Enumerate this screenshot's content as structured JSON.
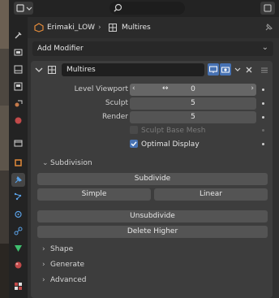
{
  "breadcrumb": {
    "object_name": "Erimaki_LOW",
    "separator": "›",
    "modifier_name": "Multires"
  },
  "add_modifier": {
    "label": "Add Modifier"
  },
  "modifier": {
    "name_value": "Multires",
    "rows": [
      {
        "label": "Level Viewport",
        "value": "0"
      },
      {
        "label": "Sculpt",
        "value": "5"
      },
      {
        "label": "Render",
        "value": "5"
      }
    ],
    "sculpt_base_mesh": {
      "label": "Sculpt Base Mesh",
      "checked": false,
      "enabled": false
    },
    "optimal_display": {
      "label": "Optimal Display",
      "checked": true
    },
    "subdivision_header": "Subdivision",
    "subdivide_label": "Subdivide",
    "simple_label": "Simple",
    "linear_label": "Linear",
    "unsubdivide_label": "Unsubdivide",
    "delete_higher_label": "Delete Higher",
    "shape_label": "Shape",
    "generate_label": "Generate",
    "advanced_label": "Advanced"
  },
  "colors": {
    "accent": "#4772b3",
    "checkbox": "#4772b3"
  },
  "icons": {
    "editor_type": "properties-icon",
    "search": "search-icon",
    "tabs": [
      "tool-icon",
      "render-icon",
      "output-icon",
      "view-layer-icon",
      "scene-icon",
      "world-icon",
      "collection-icon",
      "object-icon",
      "modifier-icon",
      "particles-icon",
      "physics-icon",
      "constraints-icon",
      "data-icon",
      "material-icon",
      "texture-icon"
    ]
  }
}
